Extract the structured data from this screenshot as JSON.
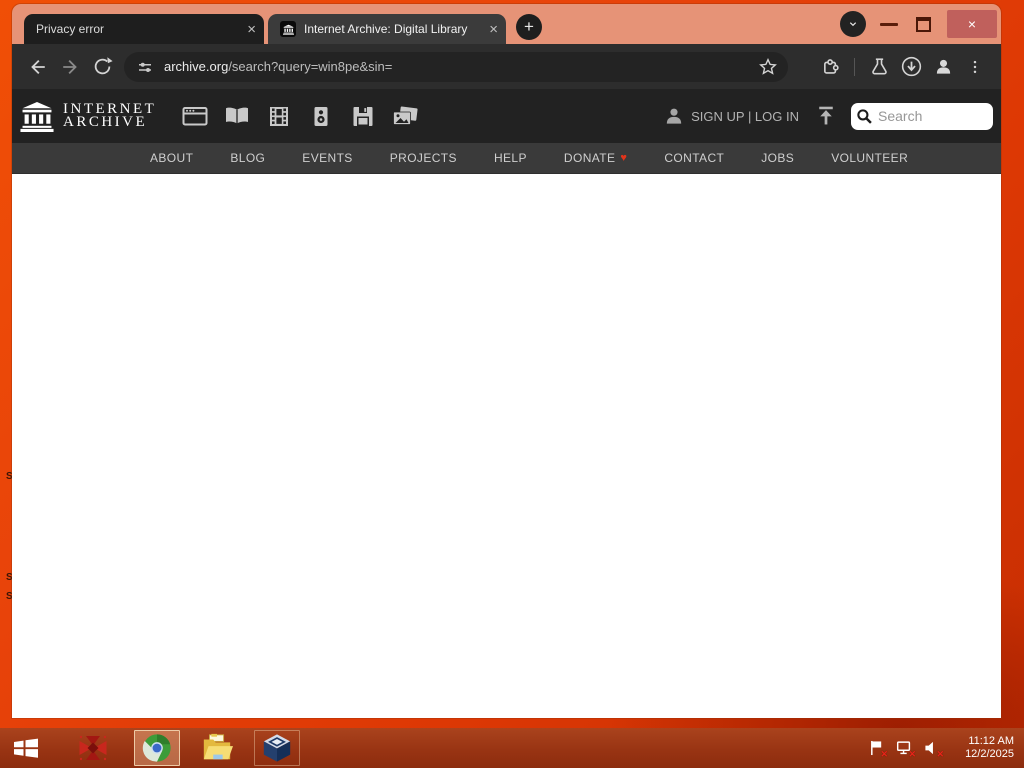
{
  "browser": {
    "tabs": [
      {
        "title": "Privacy error"
      },
      {
        "title": "Internet Archive: Digital Library"
      }
    ],
    "glyphs": {
      "close_tab": "×",
      "new_tab": "+",
      "window_close": "×"
    },
    "url": {
      "domain": "archive.org",
      "path": "/search?query=win8pe&sin="
    }
  },
  "archive": {
    "logo_line1": "INTERNET",
    "logo_line2": "ARCHIVE",
    "auth_text": "SIGN UP | LOG IN",
    "search_placeholder": "Search",
    "donate_heart": "♥",
    "nav": [
      "ABOUT",
      "BLOG",
      "EVENTS",
      "PROJECTS",
      "HELP",
      "DONATE",
      "CONTACT",
      "JOBS",
      "VOLUNTEER"
    ]
  },
  "taskbar": {
    "time": "11:12 AM",
    "date": "12/2/2025"
  },
  "desktop": {
    "icon_fragments": [
      "S",
      "S",
      "S"
    ]
  },
  "colors": {
    "desktop_orange": "#e8430a",
    "frame_salmon": "#e69377",
    "toolbar_gray": "#2d2d2d",
    "header_dark": "#222222",
    "nav_gray": "#3a3a3a",
    "taskbar_red": "#993413",
    "heart_red": "#e0341b"
  }
}
